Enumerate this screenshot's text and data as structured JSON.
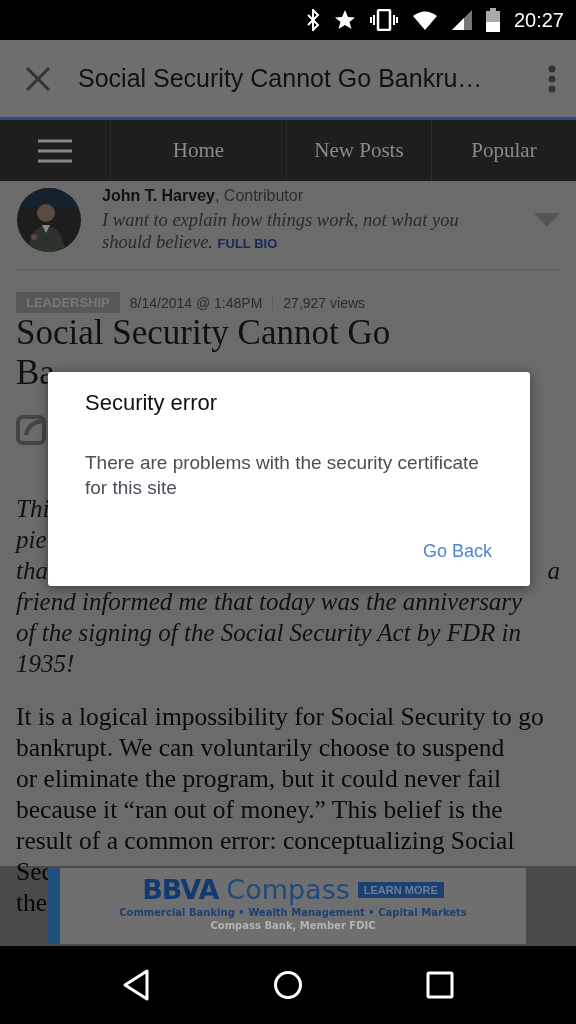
{
  "status_bar": {
    "time": "20:27"
  },
  "app_bar": {
    "title": "Social Security Cannot Go Bankru…"
  },
  "site_nav": {
    "items": [
      {
        "label": "Home"
      },
      {
        "label": "New Posts"
      },
      {
        "label": "Popular"
      }
    ]
  },
  "author": {
    "name": "John T. Harvey",
    "role": ", Contributor",
    "tagline": "I want to explain how things work, not what you should believe.",
    "bio_link": "FULL BIO"
  },
  "meta": {
    "tag": "LEADERSHIP",
    "date": "8/14/2014 @ 1:48PM",
    "views": "27,927 views"
  },
  "article": {
    "title_lines": [
      {
        "left": "Social Security Cannot Go"
      },
      {
        "left": "Ba"
      }
    ],
    "intro_lines": [
      {
        "left": "Thi"
      },
      {
        "left": "pie"
      },
      {
        "left": "tha",
        "right": "a"
      },
      {
        "left": "friend informed me that today was the anniversary"
      },
      {
        "left": "of the signing of the Social Security Act by FDR in"
      },
      {
        "left": "1935!"
      }
    ],
    "body_lines": [
      {
        "left": "It is a logical impossibility for Social Security to go"
      },
      {
        "left": "bankrupt. We can voluntarily choose to suspend"
      },
      {
        "left": "or eliminate the program, but it could never fail"
      },
      {
        "left": "because it “ran out of money.” This belief is the"
      },
      {
        "left": "result of a common error: conceptualizing Social"
      },
      {
        "left": "Sec"
      },
      {
        "left": "the"
      }
    ]
  },
  "dialog": {
    "title": "Security error",
    "message": "There are problems with the security certificate for this site",
    "button": "Go Back"
  },
  "ad": {
    "brand": "BBVA",
    "brand_rest": "Compass",
    "cta": "LEARN MORE",
    "tagline": "Commercial Banking • Wealth Management • Capital Markets",
    "disclaimer": "Compass Bank, Member FDIC"
  }
}
